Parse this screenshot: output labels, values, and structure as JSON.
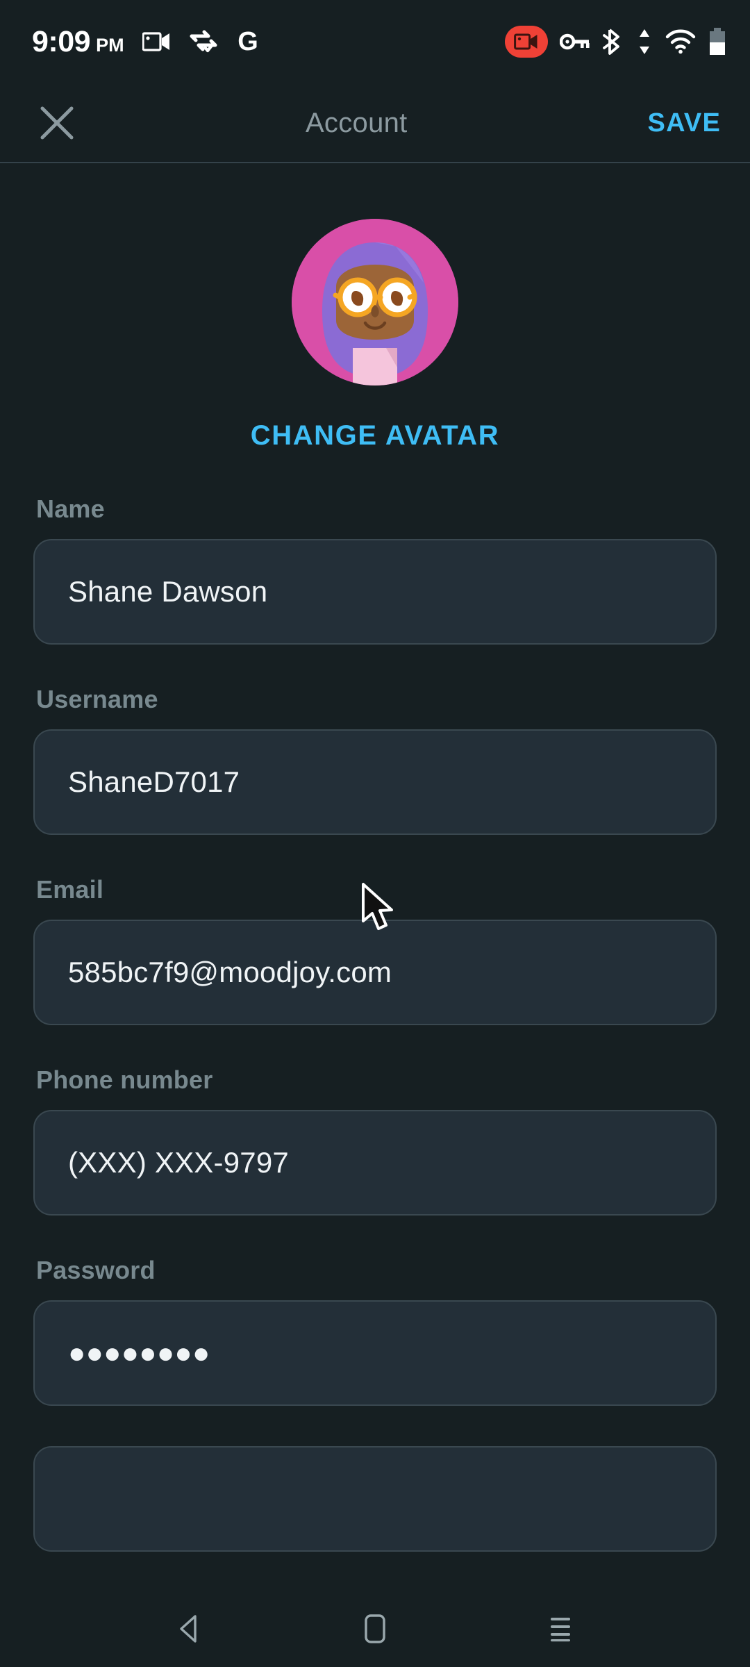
{
  "status_bar": {
    "time": "9:09",
    "ampm": "PM",
    "left_icons": [
      {
        "name": "video-camera-icon"
      },
      {
        "name": "vpn-connected-icon"
      },
      {
        "name": "google-icon"
      }
    ],
    "right_icons": [
      {
        "name": "screen-recording-badge-icon",
        "color": "#ef4136"
      },
      {
        "name": "vpn-key-icon"
      },
      {
        "name": "bluetooth-icon"
      },
      {
        "name": "data-transfer-icon"
      },
      {
        "name": "wifi-icon"
      },
      {
        "name": "battery-icon"
      }
    ]
  },
  "app_bar": {
    "close_label": "✕",
    "title": "Account",
    "save_label": "SAVE",
    "save_color": "#3fbdf5",
    "title_color": "#8c9aa0"
  },
  "avatar": {
    "change_label": "CHANGE AVATAR",
    "link_color": "#3fbdf5",
    "bg_color": "#d94fa8",
    "hair_color": "#8b6bd4",
    "skin_color": "#9c6538",
    "glasses_color": "#f5a623",
    "shirt_color": "#f5c5dc"
  },
  "form": {
    "fields": [
      {
        "name": "name",
        "label": "Name",
        "value": "Shane Dawson",
        "masked": false
      },
      {
        "name": "username",
        "label": "Username",
        "value": "ShaneD7017",
        "masked": false
      },
      {
        "name": "email",
        "label": "Email",
        "value": "585bc7f9@moodjoy.com",
        "masked": false
      },
      {
        "name": "phone-number",
        "label": "Phone number",
        "value": "(XXX) XXX-9797",
        "masked": false
      },
      {
        "name": "password",
        "label": "Password",
        "value": "●●●●●●●●",
        "masked": true,
        "dot_count": 8
      }
    ]
  },
  "nav_bar": {
    "back_label": "back-button",
    "home_label": "home-button",
    "recents_label": "recent-apps-button"
  },
  "theme": {
    "page_bg": "#161f22",
    "field_bg": "#232f38",
    "field_border": "#3a4850",
    "label_color": "#78898f",
    "value_color": "#f0f4f6",
    "accent": "#3fbdf5"
  }
}
